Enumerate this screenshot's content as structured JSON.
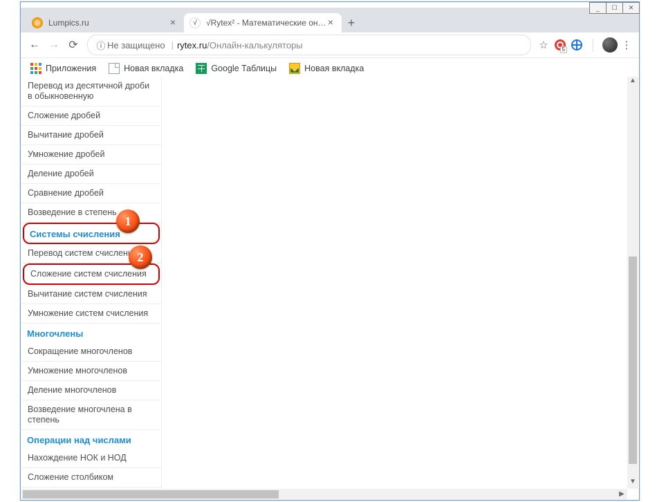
{
  "window": {
    "min": "_",
    "max": "☐",
    "close": "✕"
  },
  "tabs": {
    "inactive": {
      "title": "Lumpics.ru"
    },
    "active": {
      "title": "√Rytex² - Математические онла"
    },
    "plus": "+"
  },
  "addr": {
    "warn": "Не защищено",
    "host": "rytex.ru",
    "path": "/Онлайн-калькуляторы",
    "star": "☆",
    "badge": "5",
    "menu": "⋮"
  },
  "bookmarks": {
    "apps": "Приложения",
    "new1": "Новая вкладка",
    "sheets": "Google Таблицы",
    "new2": "Новая вкладка"
  },
  "sidebar": {
    "i1": "Перевод из десятичной дроби в обыкновенную",
    "i2": "Сложение дробей",
    "i3": "Вычитание дробей",
    "i4": "Умножение дробей",
    "i5": "Деление дробей",
    "i6": "Сравнение дробей",
    "i7": "Возведение в степень",
    "h1": "Системы счисления",
    "i8": "Перевод систем счисления",
    "i9": "Сложение систем счисления",
    "i10": "Вычитание систем счисления",
    "i11": "Умножение систем счисления",
    "h2": "Многочлены",
    "i12": "Сокращение многочленов",
    "i13": "Умножение многочленов",
    "i14": "Деление многочленов",
    "i15": "Возведение многочлена в степень",
    "h3": "Операции над числами",
    "i16": "Нахождение НОК и НОД",
    "i17": "Сложение столбиком"
  },
  "ann": {
    "b1": "1",
    "b2": "2"
  }
}
